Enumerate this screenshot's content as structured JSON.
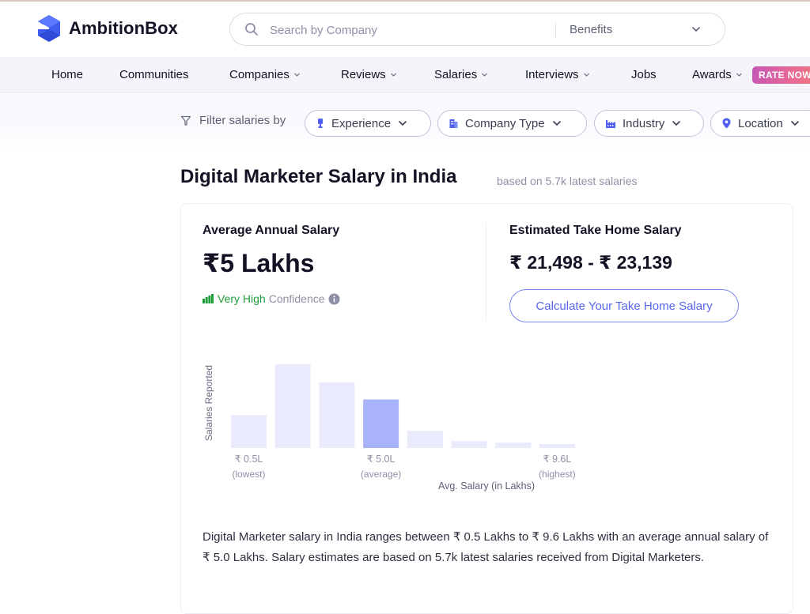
{
  "header": {
    "brand": "AmbitionBox",
    "search": {
      "placeholder": "Search by Company",
      "value": ""
    },
    "search_category": "Benefits"
  },
  "nav": {
    "items": [
      {
        "label": "Home",
        "has_dropdown": false
      },
      {
        "label": "Communities",
        "has_dropdown": false
      },
      {
        "label": "Companies",
        "has_dropdown": true
      },
      {
        "label": "Reviews",
        "has_dropdown": true
      },
      {
        "label": "Salaries",
        "has_dropdown": true
      },
      {
        "label": "Interviews",
        "has_dropdown": true
      },
      {
        "label": "Jobs",
        "has_dropdown": false
      },
      {
        "label": "Awards",
        "has_dropdown": true
      }
    ],
    "rate_badge": "RATE NOW!"
  },
  "filters": {
    "label": "Filter salaries by",
    "chips": [
      {
        "label": "Experience",
        "icon": "experience-icon"
      },
      {
        "label": "Company Type",
        "icon": "building-icon"
      },
      {
        "label": "Industry",
        "icon": "factory-icon"
      },
      {
        "label": "Location",
        "icon": "location-pin-icon"
      }
    ]
  },
  "page": {
    "title": "Digital Marketer Salary in India",
    "subtitle": "based on 5.7k latest salaries"
  },
  "summary": {
    "avg_label": "Average Annual Salary",
    "avg_value": "₹5 Lakhs",
    "confidence_level": "Very High",
    "confidence_text": "Confidence",
    "take_home_label": "Estimated Take Home Salary",
    "take_home_value": "₹ 21,498 - ₹ 23,139",
    "calc_button": "Calculate Your Take Home Salary"
  },
  "colors": {
    "accent": "#5566ea",
    "bar": "#e9ebfd",
    "bar_highlight": "#a8b3fb",
    "confidence_green": "#1f9d3a"
  },
  "chart_data": {
    "type": "bar",
    "title": "",
    "ylabel": "Salaries Reported",
    "xlabel": "Avg. Salary (in Lakhs)",
    "bins": 8,
    "values": [
      42,
      107,
      84,
      62,
      22,
      9,
      7,
      5
    ],
    "highlight_index": 3,
    "ylim": [
      0,
      110
    ],
    "grid": false,
    "tick_labels": [
      {
        "bin": 0,
        "value": "₹ 0.5L",
        "note": "(lowest)"
      },
      {
        "bin": 3,
        "value": "₹ 5.0L",
        "note": "(average)"
      },
      {
        "bin": 7,
        "value": "₹ 9.6L",
        "note": "(highest)"
      }
    ]
  },
  "description": "Digital Marketer salary in India ranges between ₹ 0.5 Lakhs to ₹ 9.6 Lakhs with an average annual salary of ₹ 5.0 Lakhs. Salary estimates are based on 5.7k latest salaries received from Digital Marketers."
}
